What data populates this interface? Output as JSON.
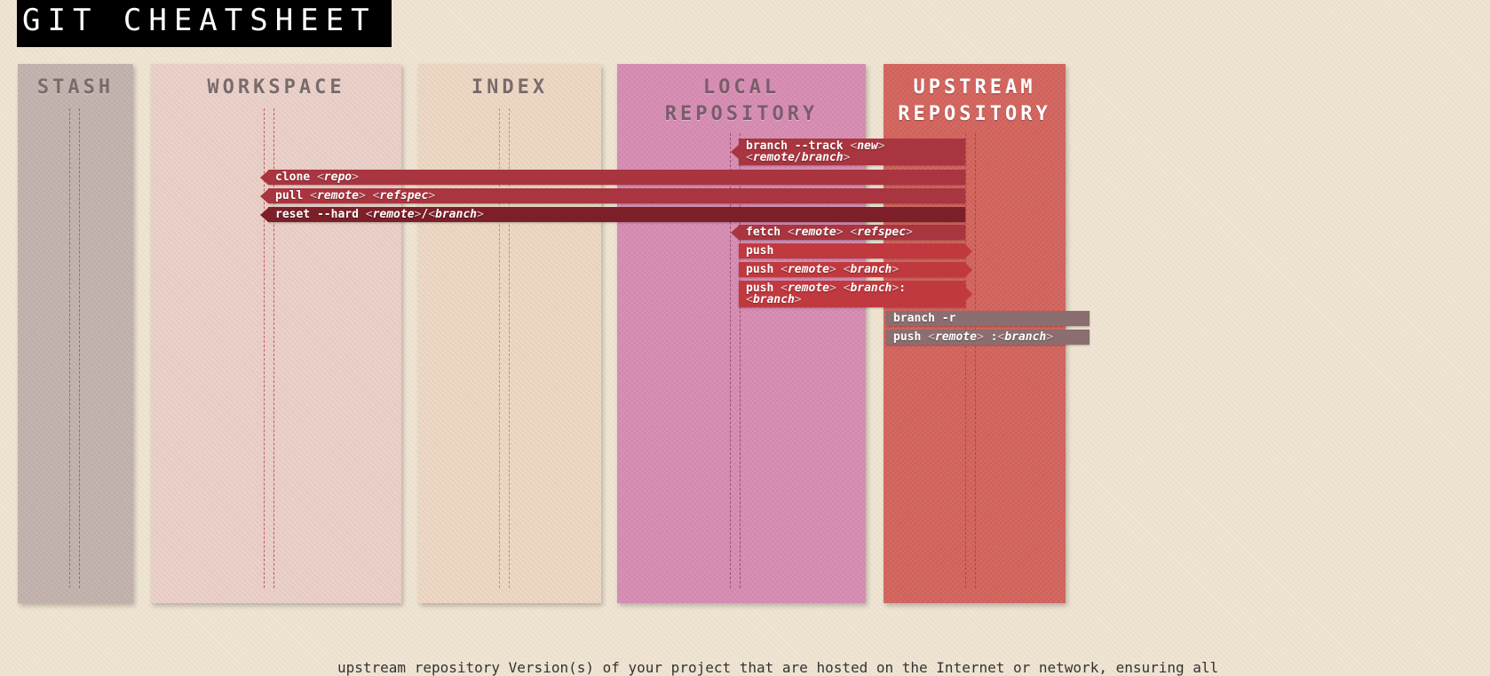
{
  "title": "GIT CHEATSHEET",
  "lanes": {
    "stash": {
      "title": "STASH",
      "color": "#c4b2ad",
      "line_color": "#a06a6a"
    },
    "workspace": {
      "title": "WORKSPACE",
      "color": "#ebd0c8",
      "line_color": "#c85a5a"
    },
    "index": {
      "title": "INDEX",
      "color": "#eed8c4",
      "line_color": "#e08a5a"
    },
    "local": {
      "title": "LOCAL\nREPOSITORY",
      "color": "#d88cb2",
      "line_color": "#a0506a"
    },
    "upstream": {
      "title": "UPSTREAM\nREPOSITORY",
      "color": "#d4635c",
      "line_color": "#a84a45"
    }
  },
  "commands": {
    "branch_track": {
      "name": "branch --track",
      "args": [
        "new",
        "remote/branch"
      ]
    },
    "clone": {
      "name": "clone",
      "args": [
        "repo"
      ]
    },
    "pull": {
      "name": "pull",
      "args": [
        "remote",
        "refspec"
      ]
    },
    "reset_hard": {
      "name": "reset --hard",
      "args": [
        "remote",
        "branch"
      ]
    },
    "fetch": {
      "name": "fetch",
      "args": [
        "remote",
        "refspec"
      ]
    },
    "push": {
      "name": "push"
    },
    "push_remote_branch": {
      "name": "push",
      "args": [
        "remote",
        "branch"
      ]
    },
    "push_remote_branch_branch": {
      "name": "push",
      "args": [
        "remote",
        "branch",
        "branch"
      ]
    },
    "branch_r": {
      "name": "branch -r"
    },
    "push_delete": {
      "name": "push",
      "args": [
        "remote",
        "branch"
      ]
    }
  },
  "colors": {
    "cmd_red": "#a8353f",
    "cmd_dark": "#7c1f28",
    "cmd_bright": "#c0393f",
    "cmd_gray": "#8a6e70"
  },
  "footer": "upstream repository  Version(s) of your project that are hosted on the Internet or network, ensuring all"
}
